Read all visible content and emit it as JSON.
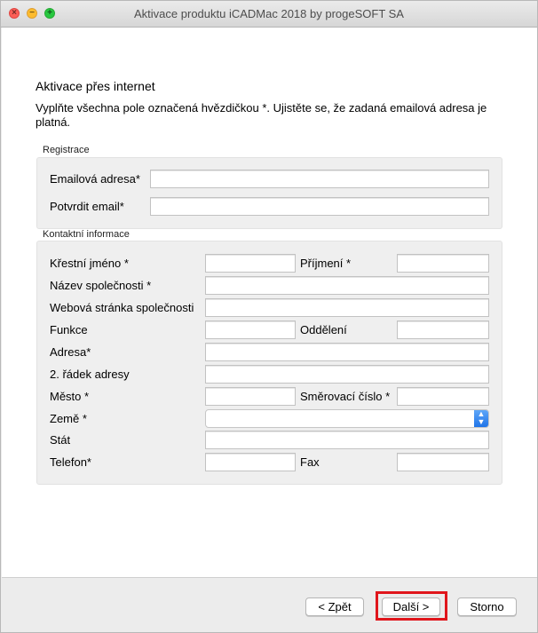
{
  "window": {
    "title": "Aktivace produktu iCADMac 2018 by progeSOFT SA"
  },
  "page": {
    "heading": "Aktivace přes internet",
    "instructions": "Vyplňte všechna pole označená hvězdičkou *. Ujistěte se, že zadaná emailová adresa je platná."
  },
  "registration": {
    "section_label": "Registrace",
    "email_label": "Emailová adresa*",
    "confirm_email_label": "Potvrdit email*"
  },
  "contact": {
    "section_label": "Kontaktní informace",
    "first_name_label": "Křestní jméno *",
    "last_name_label": "Příjmení *",
    "company_label": "Název společnosti *",
    "website_label": "Webová stránka společnosti",
    "function_label": "Funkce",
    "department_label": "Oddělení",
    "address_label": "Adresa*",
    "address2_label": "2. řádek adresy",
    "city_label": "Město *",
    "zip_label": "Směrovací číslo *",
    "country_label": "Země *",
    "state_label": "Stát",
    "phone_label": "Telefon*",
    "fax_label": "Fax"
  },
  "footer": {
    "back_label": "< Zpět",
    "next_label": "Další >",
    "cancel_label": "Storno"
  },
  "colors": {
    "highlight": "#e0161c",
    "accent": "#1f74e8"
  }
}
